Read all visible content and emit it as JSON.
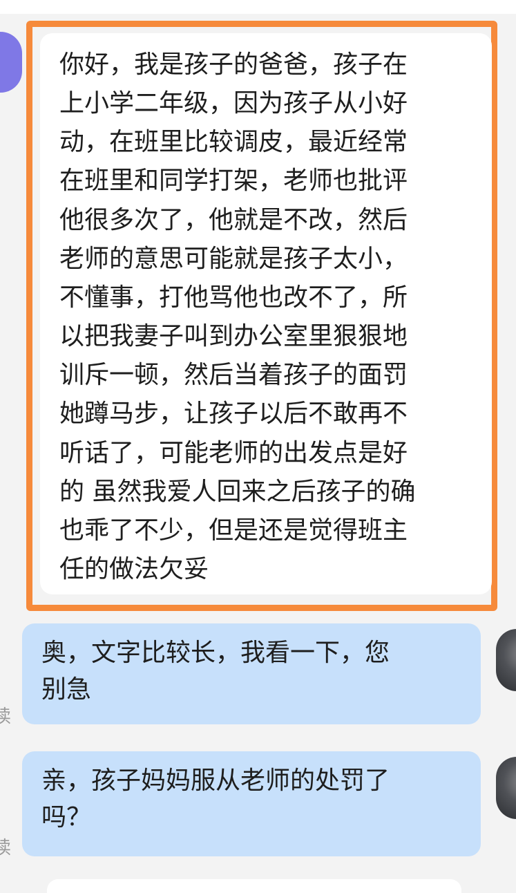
{
  "messages": [
    {
      "side": "incoming",
      "highlighted": true,
      "lines": [
        "你好，我是孩子的爸爸，孩子在",
        "上小学二年级，因为孩子从小好",
        "动，在班里比较调皮，最近经常",
        "在班里和同学打架，老师也批评",
        "他很多次了，他就是不改，然后",
        "老师的意思可能就是孩子太小，",
        "不懂事，打他骂他也改不了，所",
        "以把我妻子叫到办公室里狠狠地",
        "训斥一顿，然后当着孩子的面罚",
        "她蹲马步，让孩子以后不敢再不",
        "听话了，可能老师的出发点是好",
        "的 虽然我爱人回来之后孩子的确",
        "也乖了不少，但是还是觉得班主",
        "任的做法欠妥"
      ]
    },
    {
      "side": "outgoing",
      "lines": [
        "奥，文字比较长，我看一下，您",
        "别急"
      ],
      "read_mark": "读"
    },
    {
      "side": "outgoing",
      "lines": [
        "亲，孩子妈妈服从老师的处罚了",
        "吗？"
      ],
      "read_mark": "读"
    }
  ],
  "colors": {
    "highlight_border": "#f68a3b",
    "outgoing_bubble": "#c7e0fb",
    "incoming_bubble": "#ffffff",
    "background": "#f3f3f3",
    "avatar_left": "#7f78e6"
  }
}
